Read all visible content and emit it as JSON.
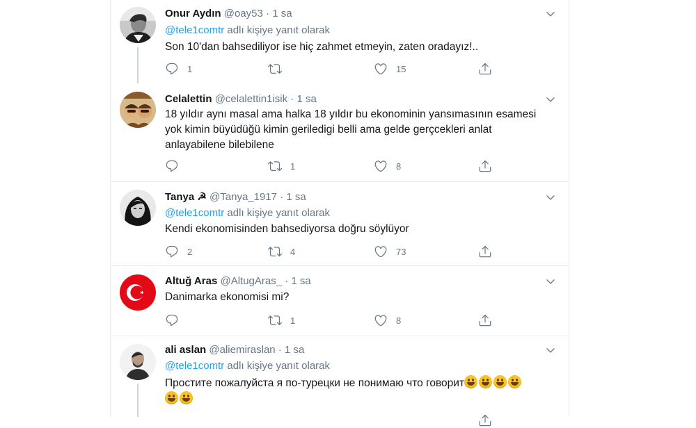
{
  "tweets": [
    {
      "name": "Onur Aydın",
      "handle": "@oay53",
      "time": "1 sa",
      "reply_to_user": "@tele1comtr",
      "reply_to_suffix": " adlı kişiye yanıt olarak",
      "text": "Son 10'dan bahsediliyor ise hiç zahmet etmeyin, zaten oradayız!..",
      "replies": "1",
      "retweets": "",
      "likes": "15"
    },
    {
      "name": "Celalettin",
      "handle": "@celalettin1isik",
      "time": "1 sa",
      "text": "18 yıldır aynı masal ama halka 18 yıldır bu ekonominin yansımasının esamesi yok kimin büyüdüğü  kimin geriledigi belli ama gelde gerçcekleri anlat anlayabilene bilebilene",
      "replies": "",
      "retweets": "1",
      "likes": "8"
    },
    {
      "name": "Tanya ☭",
      "handle": "@Tanya_1917",
      "time": "1 sa",
      "reply_to_user": "@tele1comtr",
      "reply_to_suffix": " adlı kişiye yanıt olarak",
      "text": "Kendi ekonomisinden bahsediyorsa doğru söylüyor",
      "replies": "2",
      "retweets": "4",
      "likes": "73"
    },
    {
      "name": "Altuğ Aras",
      "handle": "@AltugAras_",
      "time": "1 sa",
      "text": "Danimarka ekonomisi mi?",
      "replies": "",
      "retweets": "1",
      "likes": "8"
    },
    {
      "name": "ali aslan",
      "handle": "@aliemiraslan",
      "time": "1 sa",
      "reply_to_user": "@tele1comtr",
      "reply_to_suffix": " adlı kişiye yanıt olarak",
      "text": "Простите пожалуйста я по-турецки не понимаю что говорит"
    }
  ],
  "separator": " · ",
  "icons": {
    "reply": "reply-icon",
    "retweet": "retweet-icon",
    "like": "heart-icon",
    "share": "share-icon",
    "menu": "chevron-down-icon",
    "emoji": "grinning-face-emoji"
  },
  "colors": {
    "link": "#1da1f2",
    "secondary_text": "#657786",
    "thread_line": "#ccd6dd",
    "divider": "#e6ecf0"
  }
}
